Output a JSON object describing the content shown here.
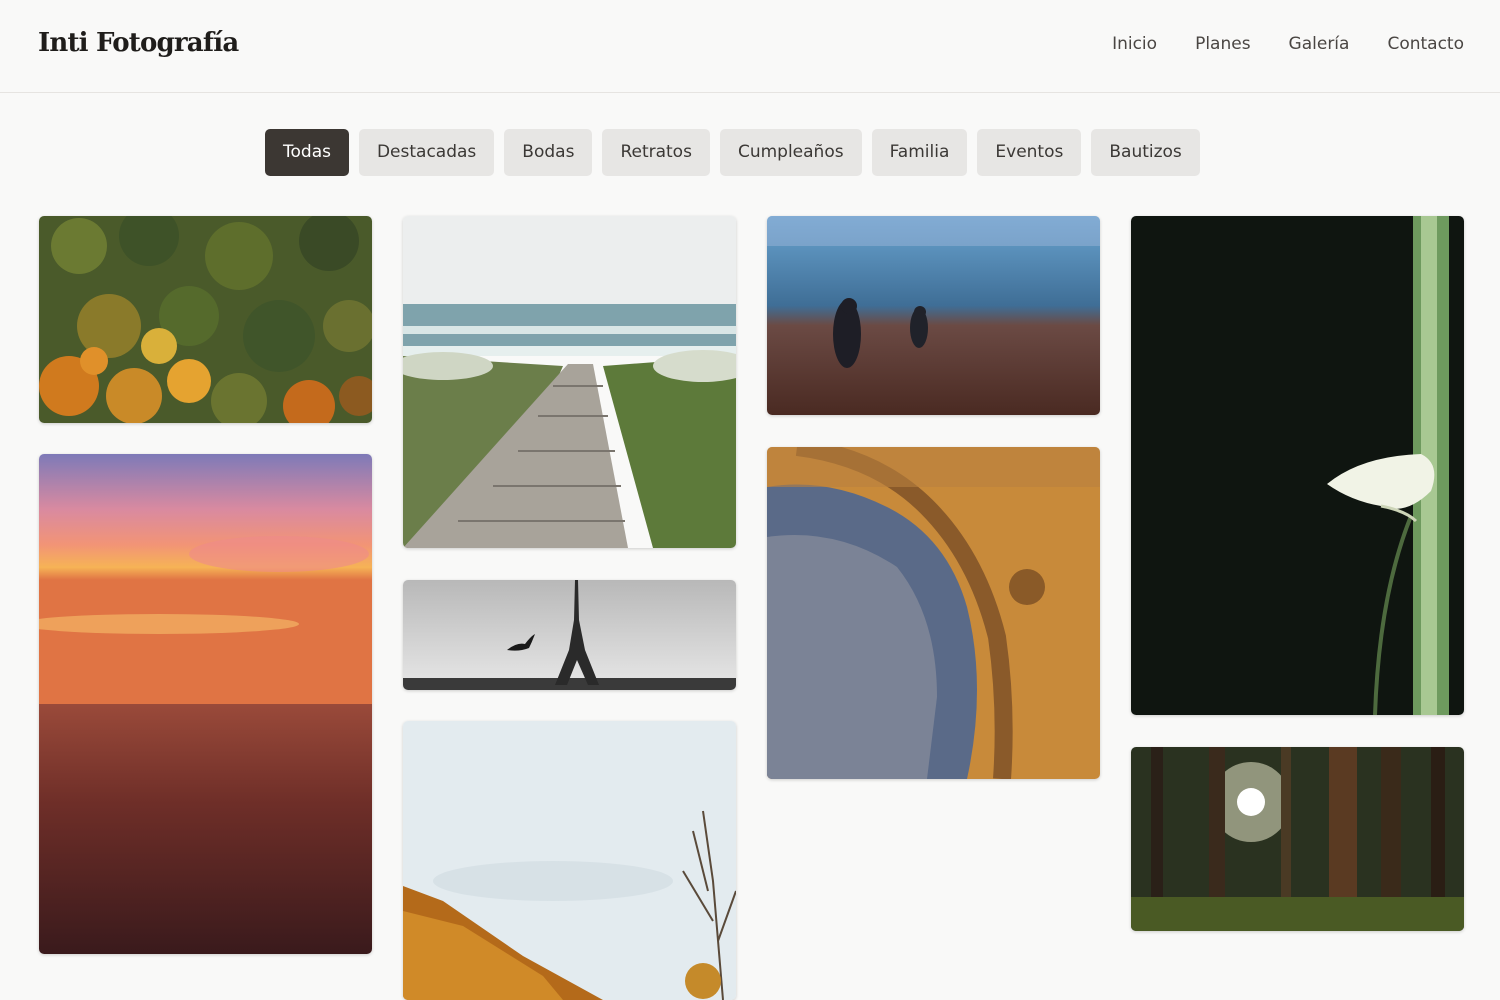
{
  "brand": {
    "name": "Inti Fotografía"
  },
  "nav": {
    "items": [
      {
        "label": "Inicio"
      },
      {
        "label": "Planes"
      },
      {
        "label": "Galería"
      },
      {
        "label": "Contacto"
      }
    ]
  },
  "filters": {
    "active": "Todas",
    "items": [
      {
        "label": "Todas"
      },
      {
        "label": "Destacadas"
      },
      {
        "label": "Bodas"
      },
      {
        "label": "Retratos"
      },
      {
        "label": "Cumpleaños"
      },
      {
        "label": "Familia"
      },
      {
        "label": "Eventos"
      },
      {
        "label": "Bautizos"
      }
    ]
  },
  "gallery": {
    "photos": [
      {
        "subject": "aerial-autumn-forest"
      },
      {
        "subject": "sunset-over-sea"
      },
      {
        "subject": "boardwalk-to-beach"
      },
      {
        "subject": "eiffel-tower-bw"
      },
      {
        "subject": "autumn-hillside-sky"
      },
      {
        "subject": "misty-field-people"
      },
      {
        "subject": "crater-aerial"
      },
      {
        "subject": "calla-lily-dark"
      },
      {
        "subject": "sunlit-forest"
      }
    ]
  },
  "colors": {
    "background": "#f9f9f8",
    "chip": "#e7e6e4",
    "chip_active": "#3c3733",
    "text": "#2e2b29"
  }
}
